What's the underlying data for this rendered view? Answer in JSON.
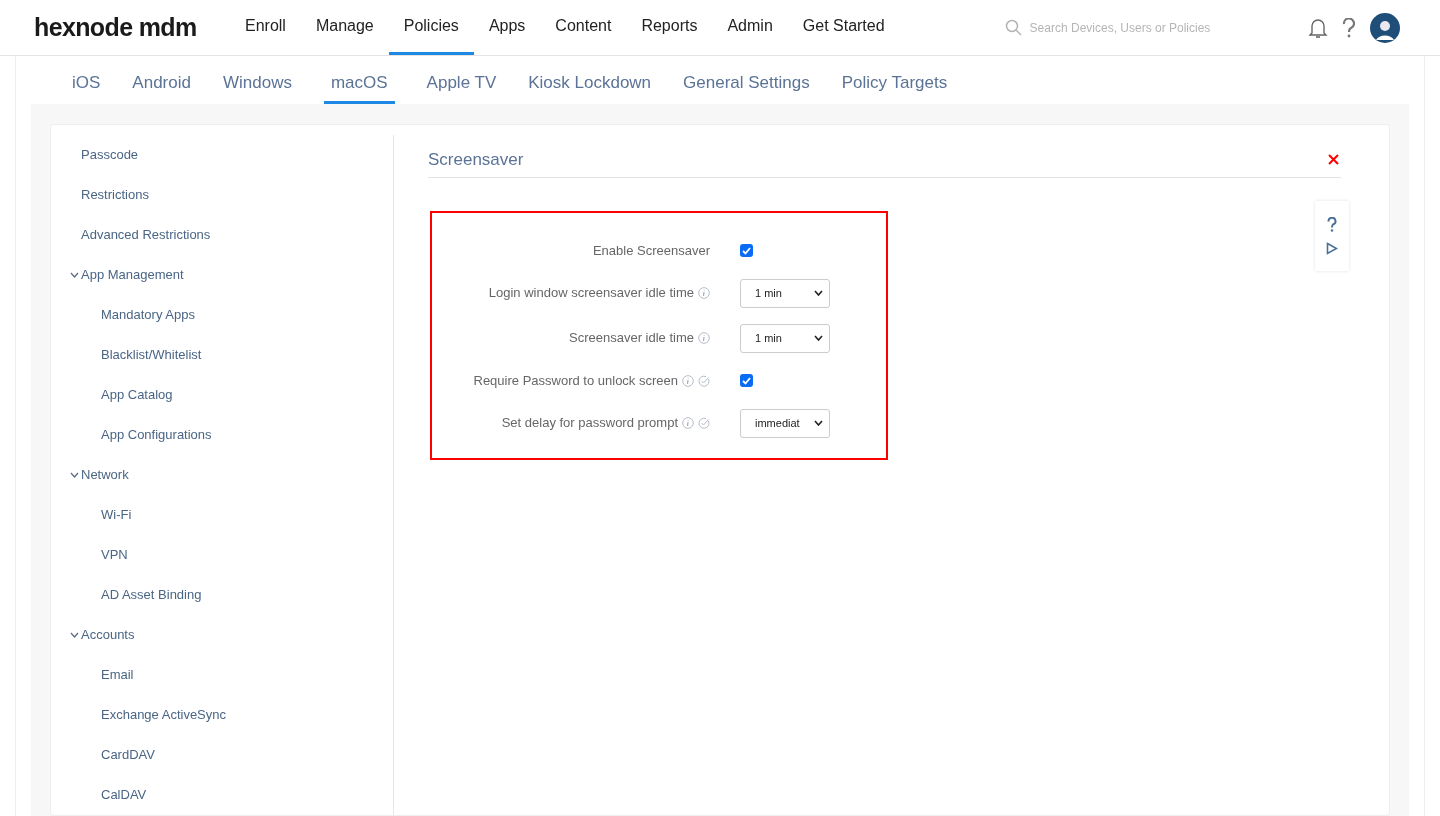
{
  "logo": "hexnode mdm",
  "nav": [
    {
      "label": "Enroll",
      "selected": false
    },
    {
      "label": "Manage",
      "selected": false
    },
    {
      "label": "Policies",
      "selected": true
    },
    {
      "label": "Apps",
      "selected": false
    },
    {
      "label": "Content",
      "selected": false
    },
    {
      "label": "Reports",
      "selected": false
    },
    {
      "label": "Admin",
      "selected": false
    },
    {
      "label": "Get Started",
      "selected": false
    }
  ],
  "search": {
    "placeholder": "Search Devices, Users or Policies"
  },
  "platform_tabs": [
    {
      "label": "iOS",
      "selected": false
    },
    {
      "label": "Android",
      "selected": false
    },
    {
      "label": "Windows",
      "selected": false
    },
    {
      "label": "macOS",
      "selected": true
    },
    {
      "label": "Apple TV",
      "selected": false
    },
    {
      "label": "Kiosk Lockdown",
      "selected": false
    },
    {
      "label": "General Settings",
      "selected": false
    },
    {
      "label": "Policy Targets",
      "selected": false
    }
  ],
  "sidebar": [
    {
      "label": "Passcode"
    },
    {
      "label": "Restrictions"
    },
    {
      "label": "Advanced Restrictions"
    },
    {
      "label": "App Management",
      "expanded": true,
      "children": [
        {
          "label": "Mandatory Apps"
        },
        {
          "label": "Blacklist/Whitelist"
        },
        {
          "label": "App Catalog"
        },
        {
          "label": "App Configurations"
        }
      ]
    },
    {
      "label": "Network",
      "expanded": true,
      "children": [
        {
          "label": "Wi-Fi"
        },
        {
          "label": "VPN"
        },
        {
          "label": "AD Asset Binding"
        }
      ]
    },
    {
      "label": "Accounts",
      "expanded": true,
      "children": [
        {
          "label": "Email"
        },
        {
          "label": "Exchange ActiveSync"
        },
        {
          "label": "CardDAV"
        },
        {
          "label": "CalDAV"
        }
      ]
    }
  ],
  "section": {
    "title": "Screensaver",
    "settings": [
      {
        "kind": "checkbox",
        "label": "Enable Screensaver",
        "checked": true
      },
      {
        "kind": "select",
        "label": "Login window screensaver idle time",
        "icons": [
          {
            "kind": "info"
          }
        ],
        "value": "1 min"
      },
      {
        "kind": "select",
        "label": "Screensaver idle time",
        "icons": [
          {
            "kind": "info"
          }
        ],
        "value": "1 min"
      },
      {
        "kind": "checkbox",
        "label": "Require Password to unlock screen",
        "icons": [
          {
            "kind": "info"
          },
          {
            "kind": "verified"
          }
        ],
        "checked": true
      },
      {
        "kind": "select",
        "label": "Set delay for password prompt",
        "icons": [
          {
            "kind": "info"
          },
          {
            "kind": "verified"
          }
        ],
        "value": "immediat"
      }
    ]
  }
}
